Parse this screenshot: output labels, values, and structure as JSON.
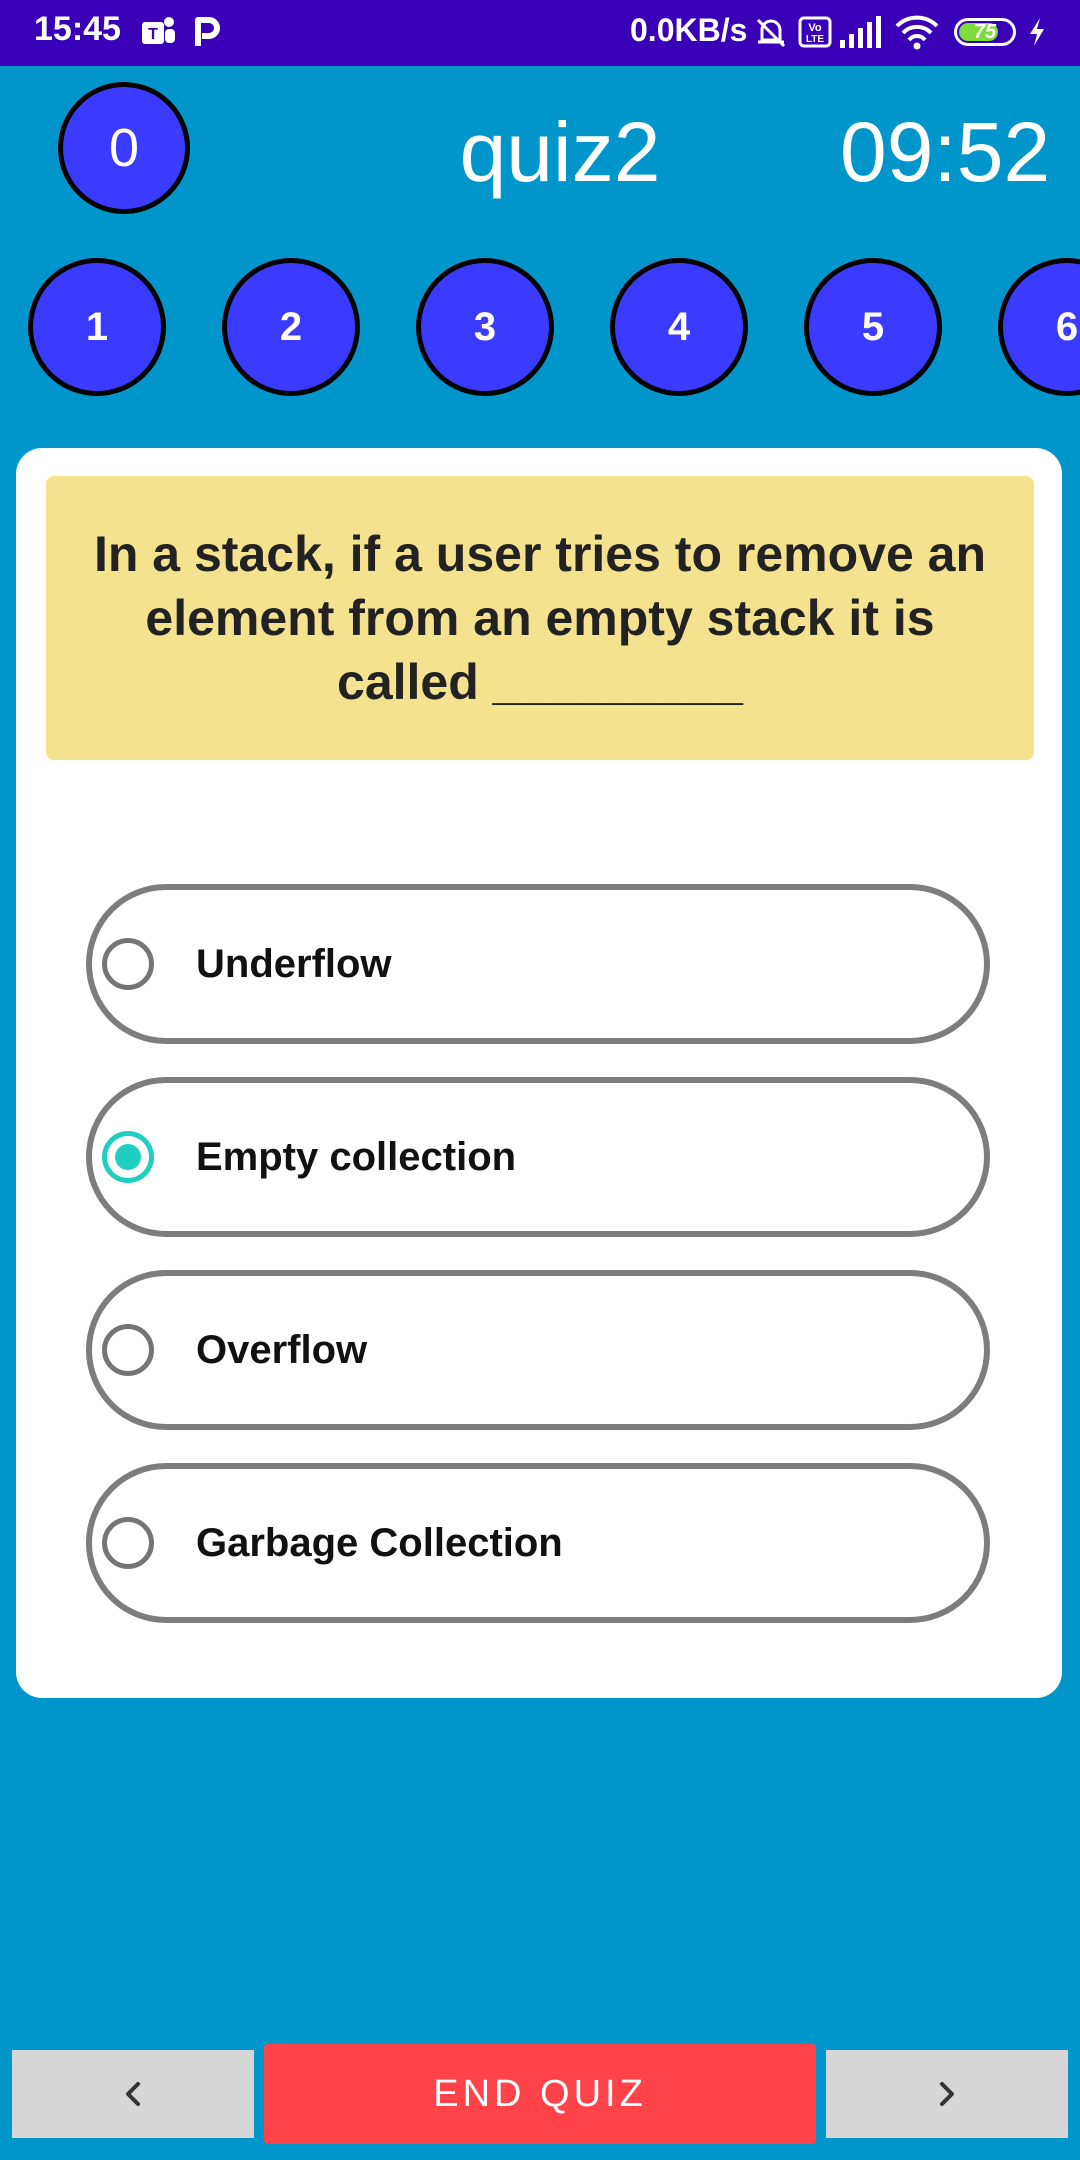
{
  "status_bar": {
    "time": "15:45",
    "net_speed": "0.0KB/s",
    "battery_level": "75",
    "battery_fraction": 0.75,
    "icons": [
      "teams-icon",
      "p-app-icon",
      "mute-bell-icon",
      "volte-icon",
      "signal-icon",
      "wifi-icon",
      "battery-icon",
      "charging-icon"
    ]
  },
  "header": {
    "score": "0",
    "title": "quiz2",
    "timer": "09:52"
  },
  "question_nav": [
    "1",
    "2",
    "3",
    "4",
    "5",
    "6"
  ],
  "question": {
    "text": "In a stack, if a user tries to remove an element from an empty stack it is called _________"
  },
  "options": [
    {
      "label": "Underflow",
      "selected": false
    },
    {
      "label": "Empty collection",
      "selected": true
    },
    {
      "label": "Overflow",
      "selected": false
    },
    {
      "label": "Garbage Collection",
      "selected": false
    }
  ],
  "bottom_bar": {
    "prev_icon": "chevron-left-icon",
    "end_label": "END QUIZ",
    "next_icon": "chevron-right-icon"
  },
  "colors": {
    "background": "#0096cc",
    "status_bar": "#3a00b8",
    "circle": "#3b3bff",
    "question_bg": "#f5e28e",
    "selected_radio": "#1fcfc1",
    "end_button": "#ff4348",
    "nav_button": "#d6d6d6"
  }
}
